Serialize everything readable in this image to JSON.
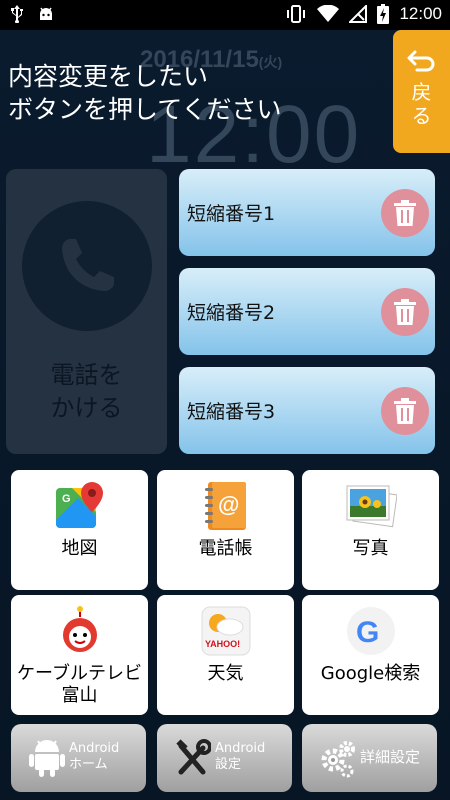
{
  "status_bar": {
    "time": "12:00"
  },
  "background": {
    "date": "2016/11/15",
    "weekday": "(火)",
    "clock": "12:00"
  },
  "instruction": {
    "line1": "内容変更をしたい",
    "line2": "ボタンを押してください"
  },
  "back_button": {
    "label": "戻る"
  },
  "call_button": {
    "line1": "電話を",
    "line2": "かける"
  },
  "speed_dials": [
    {
      "label": "短縮番号1"
    },
    {
      "label": "短縮番号2"
    },
    {
      "label": "短縮番号3"
    }
  ],
  "apps": [
    {
      "label": "地図",
      "icon": "maps-icon"
    },
    {
      "label": "電話帳",
      "icon": "contacts-icon"
    },
    {
      "label": "写真",
      "icon": "photos-icon"
    },
    {
      "label": "ケーブルテレビ富山",
      "icon": "cable-tv-mascot-icon"
    },
    {
      "label": "天気",
      "icon": "yahoo-weather-icon",
      "icon_text": "YAHOO!"
    },
    {
      "label": "Google検索",
      "icon": "google-icon",
      "icon_text": "G"
    }
  ],
  "bottom_bar": {
    "android_home": {
      "line1": "Android",
      "line2": "ホーム"
    },
    "android_settings": {
      "line1": "Android",
      "line2": "設定"
    },
    "detail_settings": {
      "label": "詳細設定"
    }
  },
  "colors": {
    "accent_orange": "#f2a81e",
    "speed_dial_blue": "#84c3ea",
    "trash_red": "#e0909a"
  }
}
